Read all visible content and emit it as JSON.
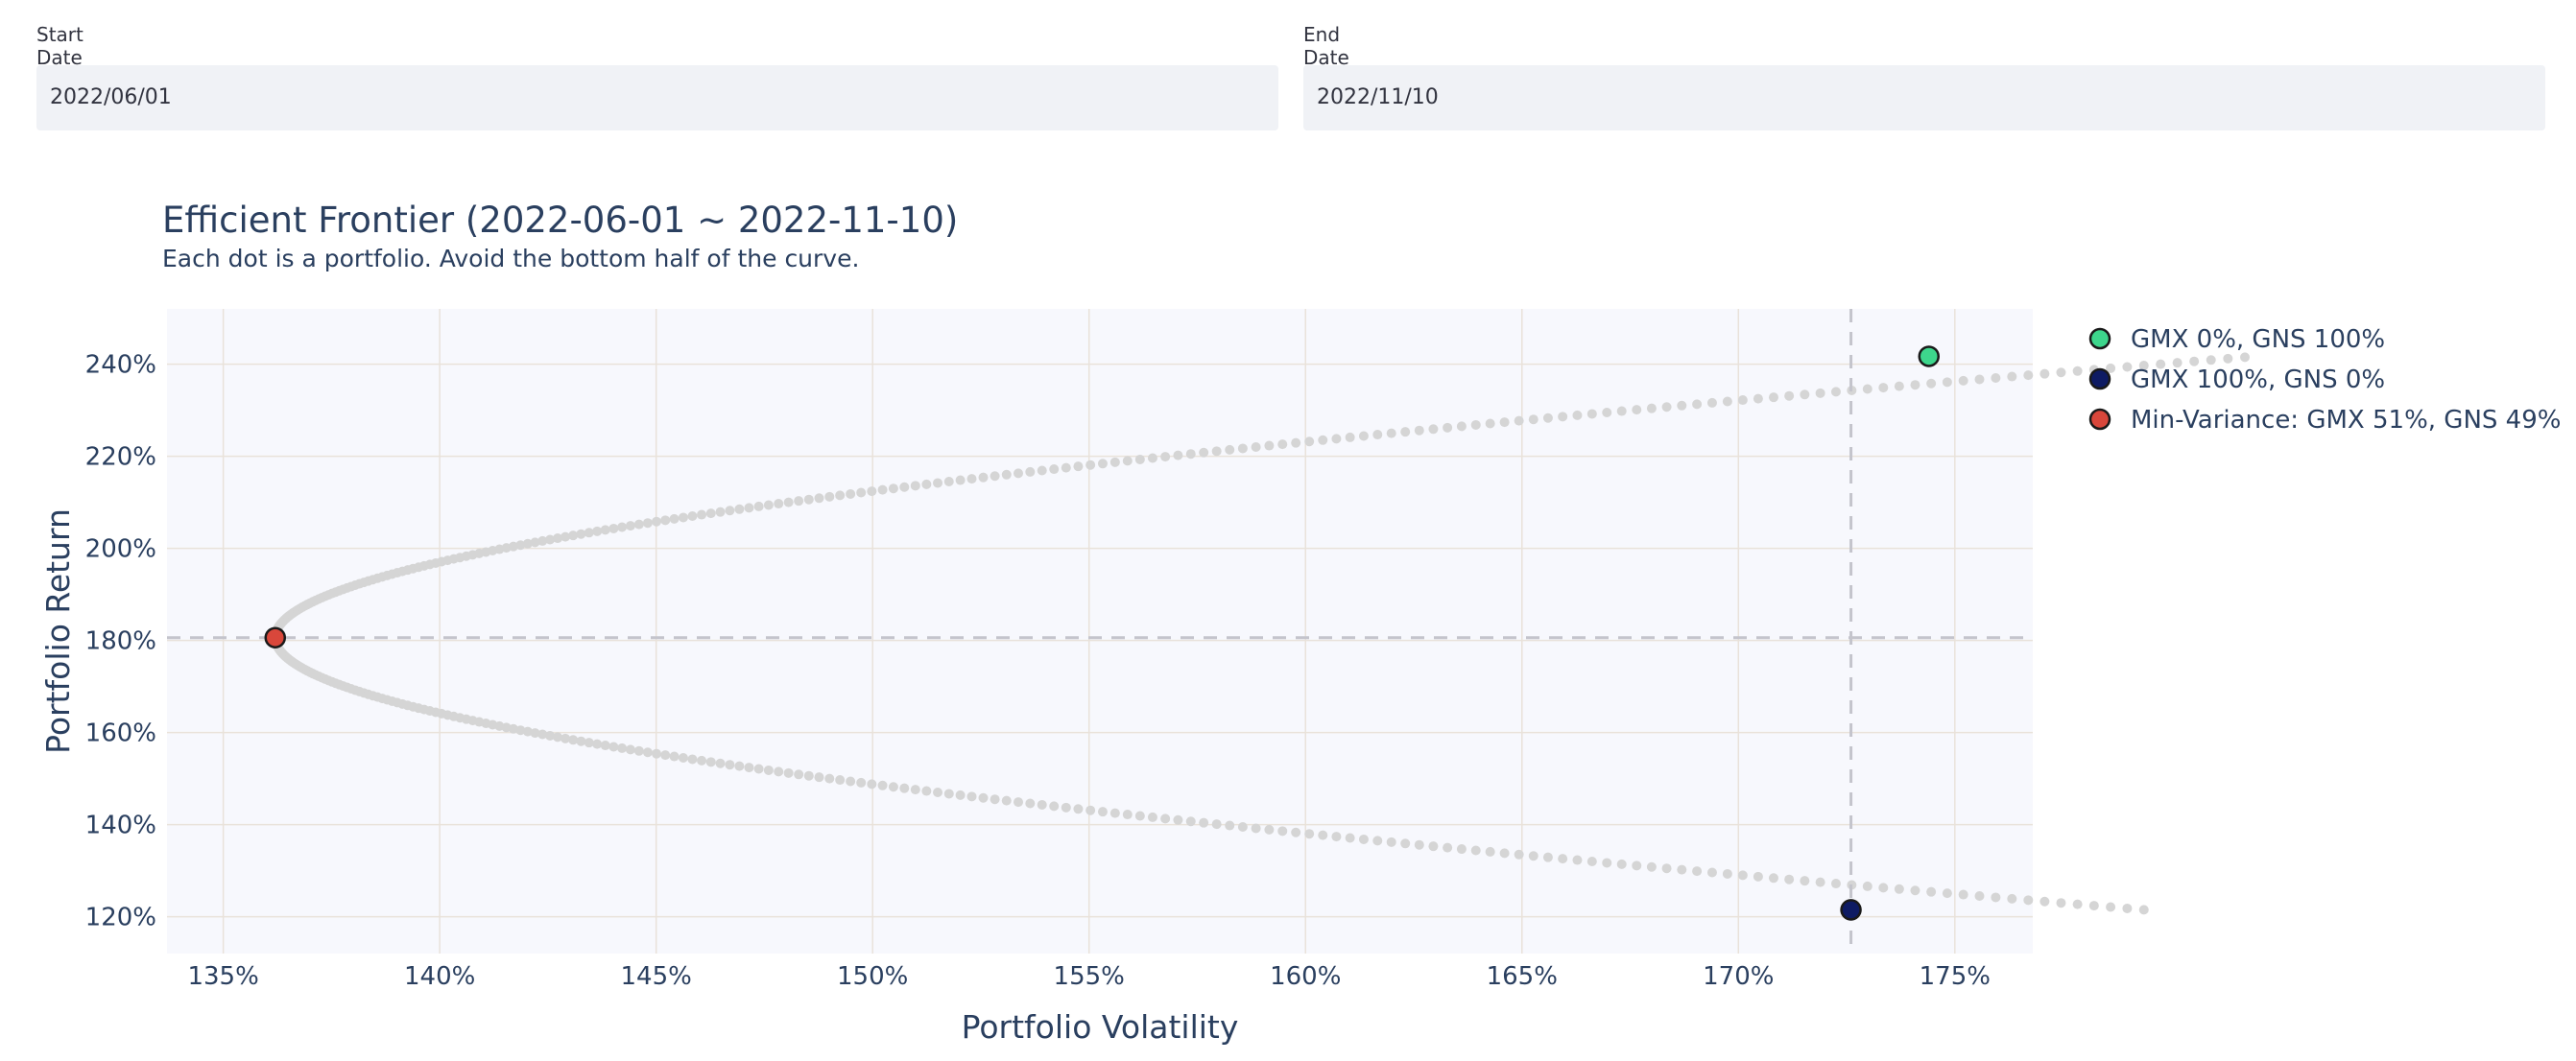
{
  "inputs": {
    "start_date": {
      "label": "Start Date",
      "value": "2022/06/01"
    },
    "end_date": {
      "label": "End Date",
      "value": "2022/11/10"
    }
  },
  "colors": {
    "plot_bg": "#f7f8fd",
    "grid": "#e9e2da",
    "frontier_dot": "#d5d5d5",
    "reference_line": "#c4c4cc",
    "gns_only": "#3dd68c",
    "gmx_only": "#0e1b63",
    "min_variance": "#d9473b"
  },
  "chart_data": {
    "type": "scatter",
    "title": "Efficient Frontier (2022-06-01 ~ 2022-11-10)",
    "subtitle": "Each dot is a portfolio. Avoid the bottom half of the curve.",
    "xlabel": "Portfolio Volatility",
    "ylabel": "Portfolio Return",
    "xlim": [
      133.7,
      176.8
    ],
    "ylim": [
      112,
      252
    ],
    "x_ticks": [
      135,
      140,
      145,
      150,
      155,
      160,
      165,
      170,
      175
    ],
    "y_ticks": [
      120,
      140,
      160,
      180,
      200,
      220,
      240
    ],
    "x_tick_labels": [
      "135%",
      "140%",
      "145%",
      "150%",
      "155%",
      "160%",
      "165%",
      "170%",
      "175%"
    ],
    "y_tick_labels": [
      "120%",
      "140%",
      "160%",
      "180%",
      "200%",
      "220%",
      "240%"
    ],
    "grid": true,
    "legend_position": "top-right outside",
    "frontier": {
      "return_min": 121.5,
      "return_max": 241.5,
      "min_variance_return": 180.6,
      "min_variance_volatility": 136.2,
      "curvature": 3.9
    },
    "reference_lines": {
      "vertical_x": 172.6,
      "horizontal_y": 180.6
    },
    "series": [
      {
        "name": "GMX 0%, GNS 100%",
        "x": 174.4,
        "y": 241.7,
        "color": "#3dd68c"
      },
      {
        "name": "GMX 100%, GNS 0%",
        "x": 172.6,
        "y": 121.5,
        "color": "#0e1b63"
      },
      {
        "name": "Min-Variance: GMX 51%, GNS 49%",
        "x": 136.2,
        "y": 180.6,
        "color": "#d9473b"
      }
    ]
  }
}
